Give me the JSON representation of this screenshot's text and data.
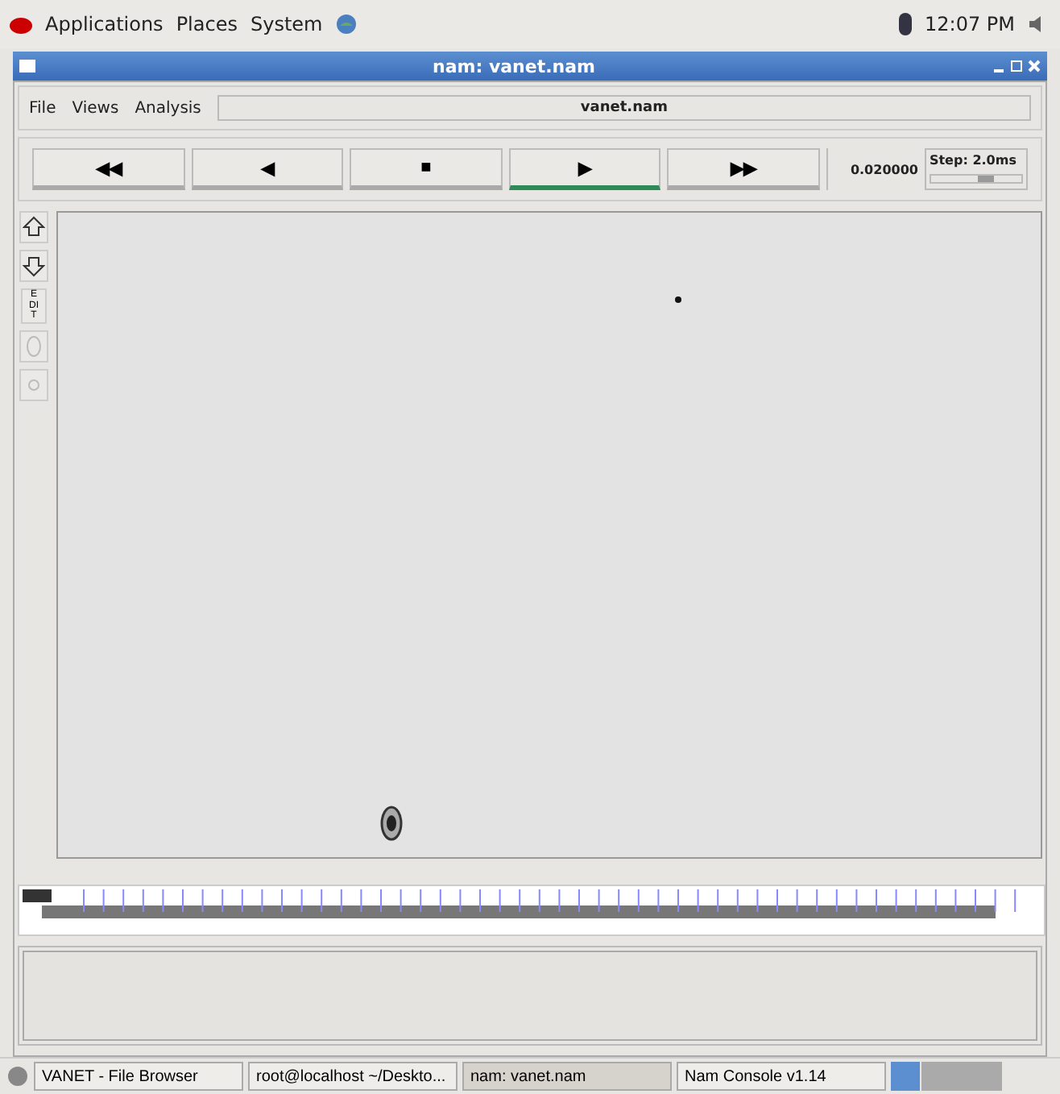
{
  "top_panel": {
    "menus": [
      "Applications",
      "Places",
      "System"
    ],
    "clock": "12:07 PM"
  },
  "window": {
    "title": "nam: vanet.nam"
  },
  "menu_bar": {
    "items": [
      "File",
      "Views",
      "Analysis"
    ],
    "file_name": "vanet.nam"
  },
  "controls": [
    {
      "label": "◀◀",
      "selected": false
    },
    {
      "label": "◀",
      "selected": false
    },
    {
      "label": "■",
      "selected": false
    },
    {
      "label": "▶",
      "selected": true
    },
    {
      "label": "▶▶",
      "selected": false
    }
  ],
  "timeline": {
    "level": 0.0
  },
  "time": "0.020000",
  "step": {
    "label": "Step: 2.0ms",
    "level": 0.6
  },
  "tools": [
    {
      "kind": "zoom-in"
    },
    {
      "kind": "zoom-out"
    },
    {
      "kind": "edit",
      "label": "EDIT"
    },
    {
      "kind": "oval"
    },
    {
      "kind": "small"
    }
  ],
  "taskbar": [
    {
      "label": "VANET - File Browser",
      "selected": false
    },
    {
      "label": "root@localhost ~/Deskto...",
      "selected": false
    },
    {
      "label": "nam: vanet.nam",
      "selected": true
    },
    {
      "label": "Nam Console v1.14",
      "selected": false
    }
  ]
}
